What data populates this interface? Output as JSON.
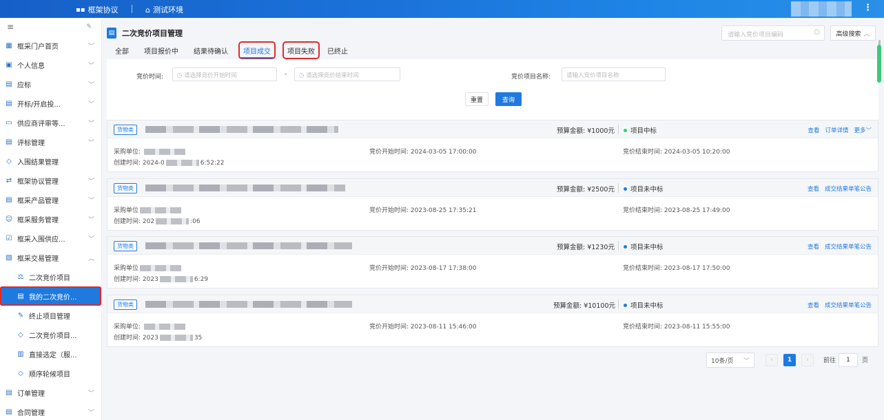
{
  "topbar": {
    "brand_icon": "grid-icon",
    "brand_label": "框架协议",
    "env_icon": "home-icon",
    "env_label": "测试环境",
    "more_icon": "⋮"
  },
  "sidebar": {
    "menu_icon": "≡",
    "pin_icon": "📌",
    "items": [
      {
        "label": "框采门户首页",
        "icon": "grid-icon",
        "chev": "﹀"
      },
      {
        "label": "个人信息",
        "icon": "person-card-icon",
        "chev": "﹀"
      },
      {
        "label": "应标",
        "icon": "doc-icon",
        "chev": "﹀"
      },
      {
        "label": "开标/开启投...",
        "icon": "doc-icon",
        "chev": "﹀"
      },
      {
        "label": "供应商评审等...",
        "icon": "monitor-icon",
        "chev": "﹀"
      },
      {
        "label": "评标管理",
        "icon": "doc-icon",
        "chev": "﹀"
      },
      {
        "label": "入围结果管理",
        "icon": "diamond-icon",
        "chev": ""
      },
      {
        "label": "框架协议管理",
        "icon": "flow-icon",
        "chev": "﹀"
      },
      {
        "label": "框采产品管理",
        "icon": "doc-icon",
        "chev": "﹀"
      },
      {
        "label": "框采服务管理",
        "icon": "service-icon",
        "chev": "﹀"
      },
      {
        "label": "框采入围供应...",
        "icon": "check-doc-icon",
        "chev": "﹀"
      },
      {
        "label": "框采交易管理",
        "icon": "trade-icon",
        "chev": "︿"
      }
    ],
    "sub_items": [
      {
        "label": "二次竞价项目",
        "icon": "gavel-icon"
      },
      {
        "label": "我的二次竞价...",
        "icon": "doc-icon"
      },
      {
        "label": "终止项目管理",
        "icon": "edit-doc-icon"
      },
      {
        "label": "二次竞价项目...",
        "icon": "diamond-icon"
      },
      {
        "label": "直接选定（服...",
        "icon": "select-icon"
      },
      {
        "label": "顺序轮候项目",
        "icon": "diamond-icon"
      }
    ],
    "bottom_items": [
      {
        "label": "订单管理",
        "icon": "doc-icon",
        "chev": "﹀"
      },
      {
        "label": "合同管理",
        "icon": "doc-icon",
        "chev": "﹀"
      }
    ]
  },
  "header": {
    "title": "二次竞价项目管理",
    "search_placeholder": "请输入竞价项目编码",
    "advanced_label": "高级搜索",
    "advanced_chev": "︿"
  },
  "tabs": [
    "全部",
    "项目报价中",
    "结果待确认",
    "项目成交",
    "项目失败",
    "已终止"
  ],
  "filters": {
    "time_label": "竞价时间:",
    "start_placeholder": "请选择竞价开始时间",
    "dash": "-",
    "end_placeholder": "请选择竞价结束时间",
    "name_label": "竞价项目名称:",
    "name_placeholder": "请输入竞价项目名称",
    "reset_label": "重置",
    "query_label": "查询"
  },
  "colors": {
    "accent": "#1f7ae0",
    "success": "#3cc97d",
    "highlight_border": "#e02a2a"
  },
  "cards": [
    {
      "tag": "货物类",
      "budget": "预算金额: ¥1000元",
      "status": "项目中标",
      "status_color": "#3cc97d",
      "actions": [
        "查看",
        "订单详情",
        "更多﹀"
      ],
      "unit_prefix": "采购单位: ",
      "created_prefix": "创建时间: 2024-0",
      "created_suffix": "6:52:22",
      "start": "竞价开始时间: 2024-03-05 17:00:00",
      "end": "竞价结束时间: 2024-03-05 10:20:00"
    },
    {
      "tag": "货物类",
      "budget": "预算金额: ¥2500元",
      "status": "项目未中标",
      "status_color": "#1f7ae0",
      "actions": [
        "查看",
        "成交结果单笔公告"
      ],
      "unit_prefix": "采购单位",
      "created_prefix": "创建时间: 202",
      "created_suffix": ":06",
      "start": "竞价开始时间: 2023-08-25 17:35:21",
      "end": "竞价结束时间: 2023-08-25 17:49:00"
    },
    {
      "tag": "货物类",
      "budget": "预算金额: ¥1230元",
      "status": "项目未中标",
      "status_color": "#1f7ae0",
      "actions": [
        "查看",
        "成交结果单笔公告"
      ],
      "unit_prefix": "采购单位",
      "created_prefix": "创建时间: 2023",
      "created_suffix": "6:29",
      "start": "竞价开始时间: 2023-08-17 17:38:00",
      "end": "竞价结束时间: 2023-08-17 17:50:00"
    },
    {
      "tag": "货物类",
      "budget": "预算金额: ¥10100元",
      "status": "项目未中标",
      "status_color": "#1f7ae0",
      "actions": [
        "查看",
        "成交结果单笔公告"
      ],
      "unit_prefix": "采购单位: ",
      "created_prefix": "创建时间: 2023",
      "created_suffix": "35",
      "start": "竞价开始时间: 2023-08-11 15:46:00",
      "end": "竞价结束时间: 2023-08-11 15:55:00"
    }
  ],
  "pagination": {
    "page_size": "10条/页",
    "prev": "‹",
    "current": "1",
    "next": "›",
    "goto_label": "前往",
    "goto_value": "1",
    "page_unit": "页"
  }
}
